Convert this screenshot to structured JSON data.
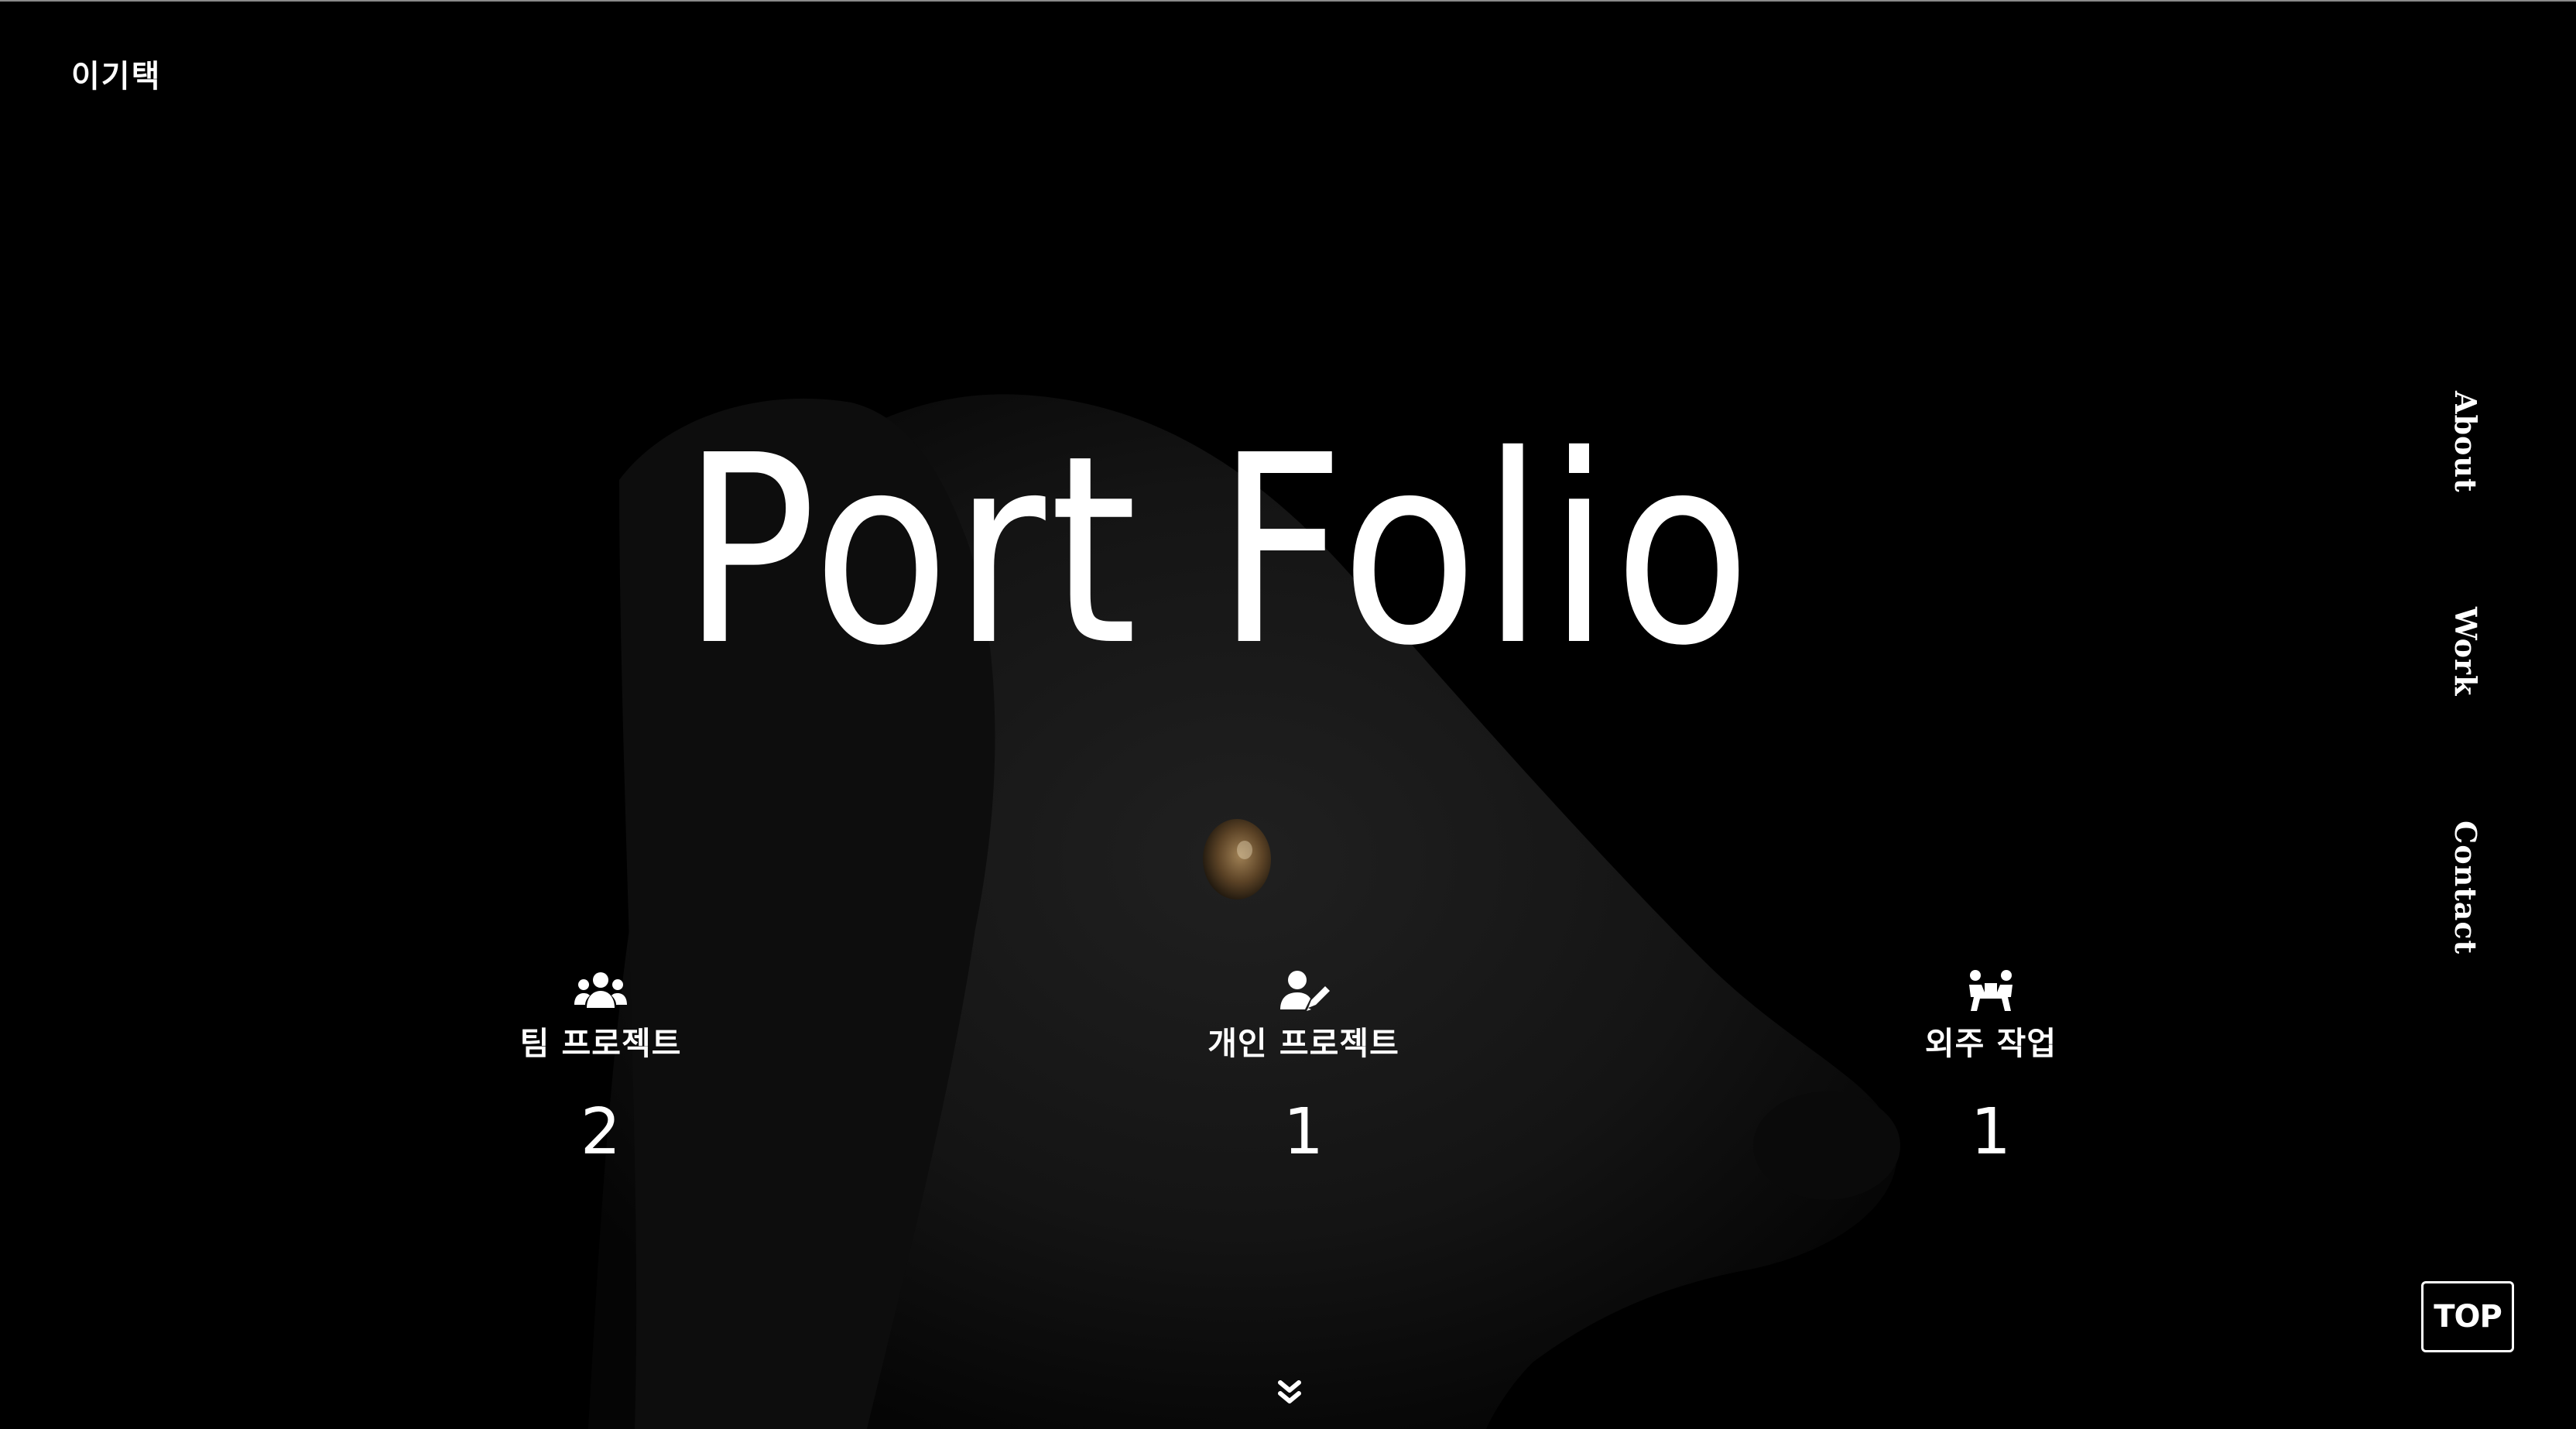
{
  "header": {
    "logo": "이기택"
  },
  "hero": {
    "title": "Port Folio"
  },
  "nav": {
    "items": [
      "About",
      "Work",
      "Contact"
    ]
  },
  "stats": [
    {
      "icon": "team-icon",
      "label": "팀 프로젝트",
      "count": "2"
    },
    {
      "icon": "person-edit-icon",
      "label": "개인 프로젝트",
      "count": "1"
    },
    {
      "icon": "collaboration-icon",
      "label": "외주 작업",
      "count": "1"
    }
  ],
  "controls": {
    "top_label": "TOP",
    "scroll_icon": "chevron-double-down-icon"
  },
  "colors": {
    "background": "#000000",
    "text": "#ffffff"
  }
}
